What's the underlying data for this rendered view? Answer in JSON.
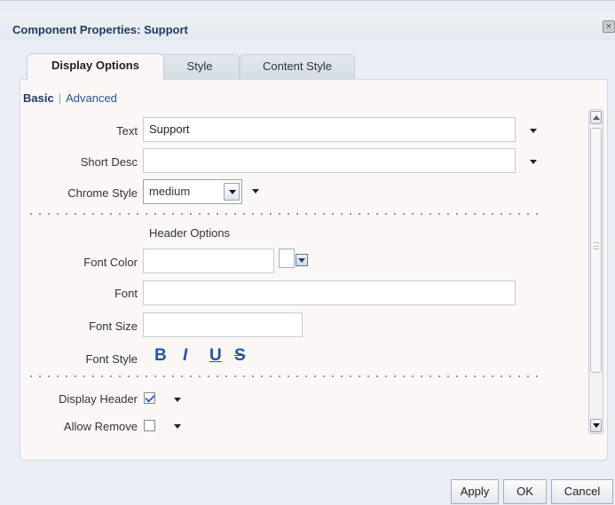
{
  "dialog": {
    "title": "Component Properties: Support",
    "close_glyph": "×"
  },
  "tabs": [
    {
      "label": "Display Options",
      "active": true
    },
    {
      "label": "Style",
      "active": false
    },
    {
      "label": "Content Style",
      "active": false
    }
  ],
  "subnav": {
    "basic": "Basic",
    "separator": "|",
    "advanced": "Advanced"
  },
  "fields": {
    "text": {
      "label": "Text",
      "value": "Support"
    },
    "short_desc": {
      "label": "Short Desc",
      "value": ""
    },
    "chrome_style": {
      "label": "Chrome Style",
      "value": "medium"
    }
  },
  "header_options": {
    "title": "Header Options",
    "font_color": {
      "label": "Font Color",
      "value": ""
    },
    "font": {
      "label": "Font",
      "value": ""
    },
    "font_size": {
      "label": "Font Size",
      "value": ""
    },
    "font_style": {
      "label": "Font Style",
      "bold": "B",
      "italic": "I",
      "underline": "U",
      "strike": "S"
    }
  },
  "checkboxes": {
    "display_header": {
      "label": "Display Header",
      "checked": true
    },
    "allow_remove": {
      "label": "Allow Remove",
      "checked": false
    }
  },
  "footer": {
    "apply": "Apply",
    "ok": "OK",
    "cancel": "Cancel"
  },
  "colors": {
    "title": "#1f3a5f",
    "link": "#2a5593",
    "font_style_icons": "#1f56a4",
    "panel_bg": "#fbf7f7",
    "dialog_bg": "#e9eef4"
  }
}
